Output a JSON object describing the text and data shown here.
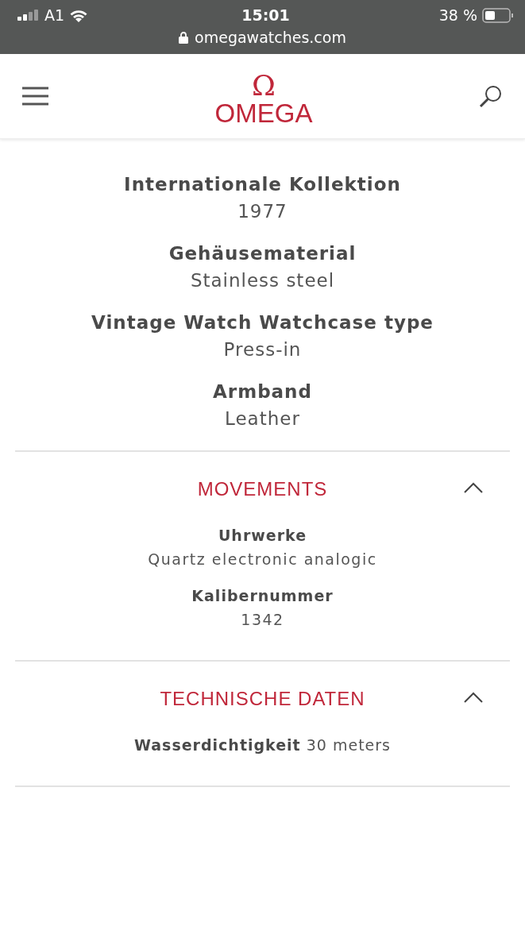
{
  "status_bar": {
    "carrier": "A1",
    "time": "15:01",
    "battery": "38 %",
    "url": "omegawatches.com"
  },
  "header": {
    "logo_symbol": "Ω",
    "logo_wordmark": "OMEGA"
  },
  "specs": [
    {
      "label": "Internationale Kollektion",
      "value": "1977"
    },
    {
      "label": "Gehäusematerial",
      "value": "Stainless steel"
    },
    {
      "label": "Vintage Watch Watchcase type",
      "value": "Press-in"
    },
    {
      "label": "Armband",
      "value": "Leather"
    }
  ],
  "sections": [
    {
      "title": "MOVEMENTS",
      "expanded": true,
      "items": [
        {
          "kind": "stacked",
          "label": "Uhrwerke",
          "value": "Quartz electronic analogic"
        },
        {
          "kind": "stacked",
          "label": "Kalibernummer",
          "value": "1342"
        }
      ]
    },
    {
      "title": "TECHNISCHE DATEN",
      "expanded": true,
      "items": [
        {
          "kind": "inline",
          "label": "Wasserdichtigkeit",
          "value": "30 meters"
        }
      ]
    }
  ]
}
